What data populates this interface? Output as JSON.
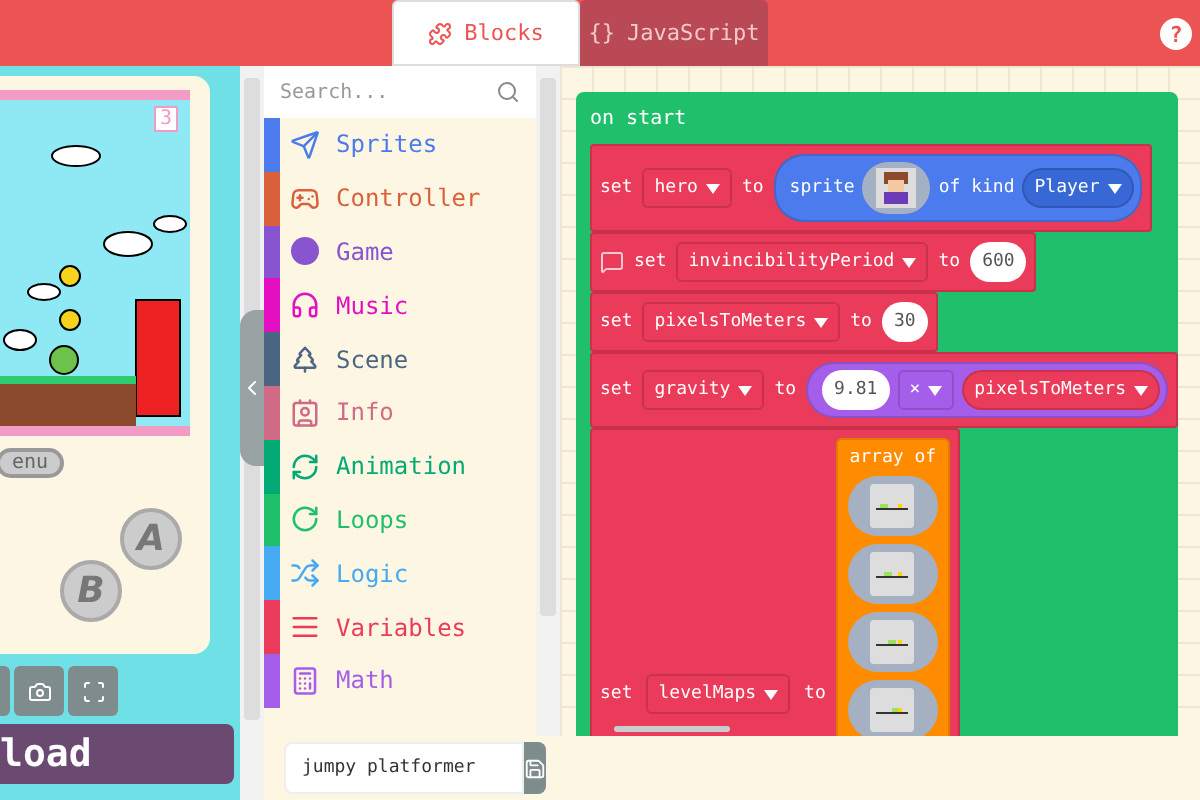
{
  "tabs": [
    {
      "label": "Blocks",
      "selected": true
    },
    {
      "label": "JavaScript",
      "icon_text": "{}",
      "selected": false
    }
  ],
  "help": "?",
  "simulator": {
    "score": "3",
    "menu_button": "enu",
    "a_button": "A",
    "b_button": "B",
    "download_button": "load"
  },
  "toolbox": {
    "search": {
      "placeholder": "Search..."
    },
    "categories": [
      {
        "label": "Sprites",
        "color": "#4b7bec",
        "kind": "plane"
      },
      {
        "label": "Controller",
        "color": "#d9603b",
        "kind": "gamepad"
      },
      {
        "label": "Game",
        "color": "#8854d0",
        "kind": "circle"
      },
      {
        "label": "Music",
        "color": "#e30fc0",
        "kind": "headphones"
      },
      {
        "label": "Scene",
        "color": "#4b6584",
        "kind": "tree"
      },
      {
        "label": "Info",
        "color": "#cf6a87",
        "kind": "card"
      },
      {
        "label": "Animation",
        "color": "#03aa74",
        "kind": "cycle"
      },
      {
        "label": "Loops",
        "color": "#20bf6b",
        "kind": "loop"
      },
      {
        "label": "Logic",
        "color": "#45aaf2",
        "kind": "shuffle"
      },
      {
        "label": "Variables",
        "color": "#eb3b5a",
        "kind": "lines"
      },
      {
        "label": "Math",
        "color": "#a55eea",
        "kind": "calculator"
      }
    ],
    "project_name": "jumpy platformer"
  },
  "workspace": {
    "on_start": "on start",
    "statements": [
      {
        "kind": "sprite",
        "has_comment": false,
        "keyword": "set",
        "variable": "hero",
        "to": "to",
        "sprite_label": "sprite",
        "of_kind": "of kind",
        "sprite_kind": "Player"
      },
      {
        "kind": "number",
        "has_comment": true,
        "keyword": "set",
        "variable": "invincibilityPeriod",
        "to": "to",
        "value": "600"
      },
      {
        "kind": "number",
        "has_comment": false,
        "keyword": "set",
        "variable": "pixelsToMeters",
        "to": "to",
        "value": "30"
      },
      {
        "kind": "multiply",
        "has_comment": false,
        "keyword": "set",
        "variable": "gravity",
        "to": "to",
        "value": "9.81",
        "operator": "×",
        "operand": "pixelsToMeters"
      },
      {
        "kind": "array",
        "has_comment": false,
        "keyword": "set",
        "variable": "levelMaps",
        "to": "to",
        "array_label": "array of"
      }
    ]
  }
}
